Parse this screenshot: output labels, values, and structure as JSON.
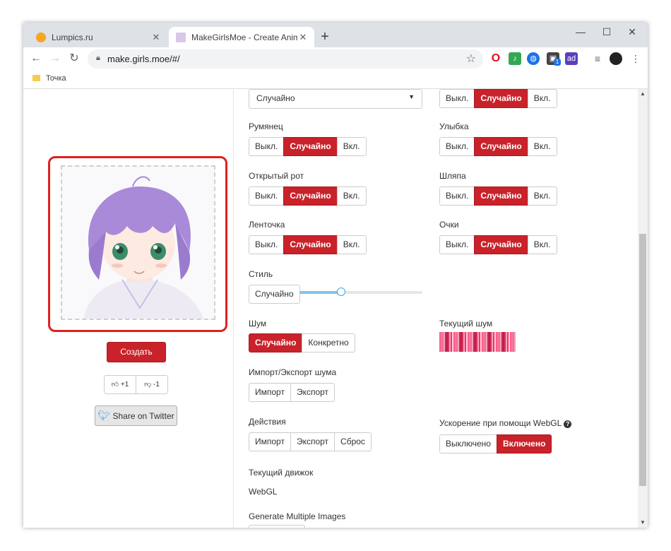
{
  "browser": {
    "tabs": [
      {
        "title": "Lumpics.ru",
        "close": "✕"
      },
      {
        "title": "MakeGirlsMoe - Create Anime Characters with A.I.!",
        "close": "✕"
      }
    ],
    "new_tab": "+",
    "window_controls": {
      "minimize": "—",
      "maximize": "☐",
      "close": "✕"
    },
    "url": "make.girls.moe/#/",
    "bookmark": "Точка",
    "extensions": [
      "opera-icon",
      "music-icon",
      "globe-icon",
      "box-icon",
      "ad-icon",
      "list-icon",
      "avatar"
    ],
    "extension_badge": "1"
  },
  "left": {
    "create_label": "Создать",
    "vote_up": "+1",
    "vote_down": "-1",
    "twitter_label": "Share on Twitter"
  },
  "right": {
    "hair_style_select": "Случайно",
    "top_right_toggle": [
      "Выкл.",
      "Случайно",
      "Вкл."
    ],
    "blush": {
      "label": "Румянец",
      "options": [
        "Выкл.",
        "Случайно",
        "Вкл."
      ]
    },
    "smile": {
      "label": "Улыбка",
      "options": [
        "Выкл.",
        "Случайно",
        "Вкл."
      ]
    },
    "open_mouth": {
      "label": "Открытый рот",
      "options": [
        "Выкл.",
        "Случайно",
        "Вкл."
      ]
    },
    "hat": {
      "label": "Шляпа",
      "options": [
        "Выкл.",
        "Случайно",
        "Вкл."
      ]
    },
    "ribbon": {
      "label": "Ленточка",
      "options": [
        "Выкл.",
        "Случайно",
        "Вкл."
      ]
    },
    "glasses": {
      "label": "Очки",
      "options": [
        "Выкл.",
        "Случайно",
        "Вкл."
      ]
    },
    "style": {
      "label": "Стиль",
      "button": "Случайно",
      "slider_value": 0.34
    },
    "noise": {
      "label": "Шум",
      "options": [
        "Случайно",
        "Конкретно"
      ]
    },
    "current_noise": {
      "label": "Текущий шум"
    },
    "import_export": {
      "label": "Импорт/Экспорт шума",
      "options": [
        "Импорт",
        "Экспорт"
      ]
    },
    "actions": {
      "label": "Действия",
      "options": [
        "Импорт",
        "Экспорт",
        "Сброс"
      ]
    },
    "webgl": {
      "label": "Ускорение при помощи WebGL",
      "help": "?",
      "options": [
        "Выключено",
        "Включено"
      ]
    },
    "engine": {
      "label": "Текущий движок",
      "value": "WebGL"
    },
    "multiple": {
      "label": "Generate Multiple Images"
    }
  },
  "colors": {
    "accent": "#c9222a",
    "highlight": "#e02020",
    "slider": "#7fc6e8"
  }
}
